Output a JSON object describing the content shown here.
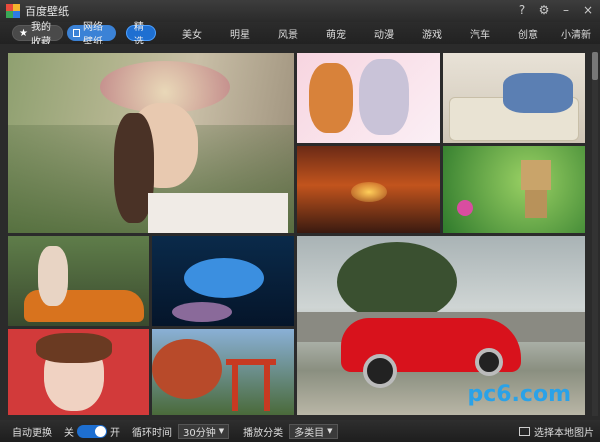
{
  "app": {
    "title": "百度壁纸"
  },
  "window_controls": {
    "help": "?",
    "settings": "⚙",
    "minimize": "–",
    "close": "×"
  },
  "toolbar": {
    "favorites_label": "我的收藏",
    "network_label": "网络壁纸",
    "selected_label": "精选",
    "categories": [
      "美女",
      "明星",
      "风景",
      "萌宠",
      "动漫",
      "游戏",
      "汽车",
      "创意",
      "小清新"
    ]
  },
  "statusbar": {
    "auto_change_label": "自动更换",
    "off_label": "关",
    "on_label": "开",
    "cycle_label": "循环时间",
    "cycle_value": "30分钟",
    "play_category_label": "播放分类",
    "play_category_value": "多类目",
    "local_button_label": "选择本地图片"
  },
  "watermark": {
    "text": "pc6.com"
  },
  "colors": {
    "accent": "#1e6fd1",
    "titlebar": "#333333"
  }
}
